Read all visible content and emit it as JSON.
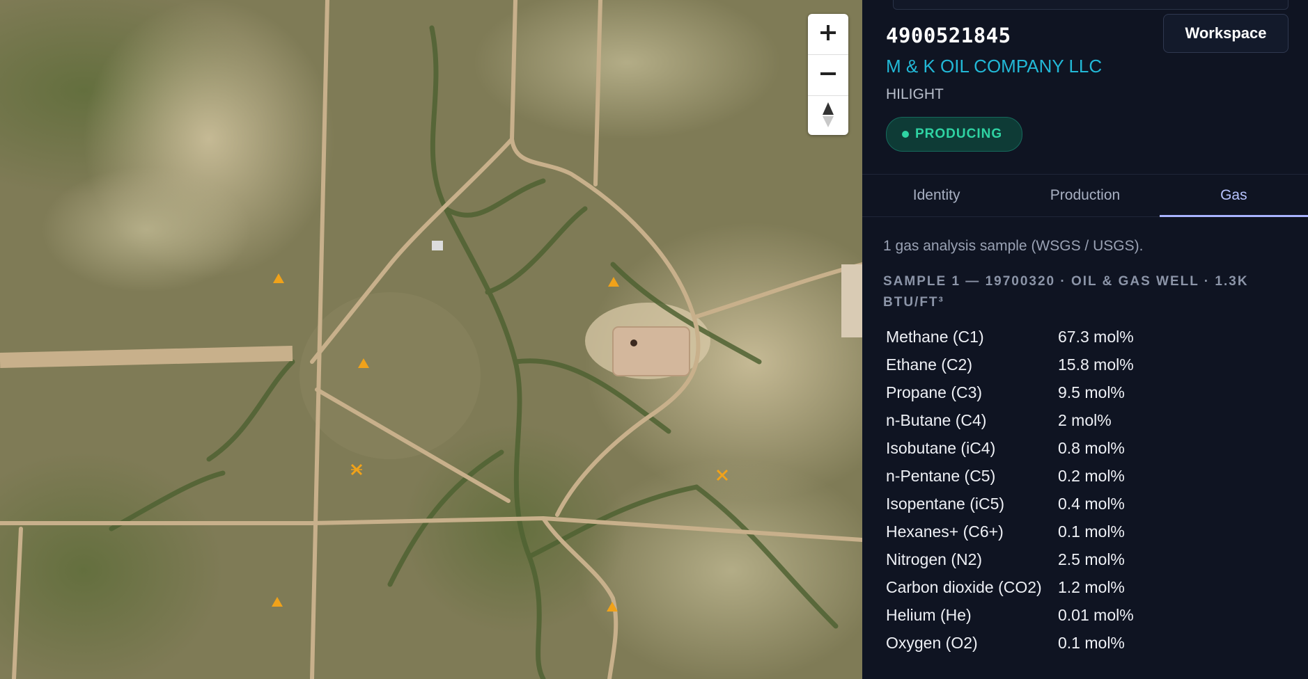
{
  "map": {
    "zoom_in_icon": "plus-icon",
    "zoom_out_icon": "minus-icon",
    "compass_icon": "compass-north-icon",
    "marker_color": "#f0a21a",
    "markers": [
      {
        "type": "triangle",
        "icon": "well-triangle-icon"
      },
      {
        "type": "triangle",
        "icon": "well-triangle-icon"
      },
      {
        "type": "triangle",
        "icon": "well-triangle-icon"
      },
      {
        "type": "cross",
        "icon": "plugged-well-cross-icon"
      },
      {
        "type": "cross",
        "icon": "plugged-well-cross-icon"
      },
      {
        "type": "triangle",
        "icon": "well-triangle-icon"
      },
      {
        "type": "triangle",
        "icon": "well-triangle-icon"
      }
    ]
  },
  "well": {
    "api": "4900521845",
    "operator": "M & K OIL COMPANY LLC",
    "name": "HILIGHT",
    "status": "PRODUCING",
    "status_color": "#2fd3a3"
  },
  "header": {
    "workspace_label": "Workspace"
  },
  "tabs": [
    {
      "label": "Identity",
      "active": false
    },
    {
      "label": "Production",
      "active": false
    },
    {
      "label": "Gas",
      "active": true
    }
  ],
  "gas": {
    "summary": "1 gas analysis sample (WSGS / USGS).",
    "sample_heading": "SAMPLE 1 — 19700320 · OIL & GAS WELL · 1.3K BTU/FT³",
    "components": [
      {
        "name": "Methane (C1)",
        "value": "67.3 mol%"
      },
      {
        "name": "Ethane (C2)",
        "value": "15.8 mol%"
      },
      {
        "name": "Propane (C3)",
        "value": "9.5 mol%"
      },
      {
        "name": "n-Butane (C4)",
        "value": "2 mol%"
      },
      {
        "name": "Isobutane (iC4)",
        "value": "0.8 mol%"
      },
      {
        "name": "n-Pentane (C5)",
        "value": "0.2 mol%"
      },
      {
        "name": "Isopentane (iC5)",
        "value": "0.4 mol%"
      },
      {
        "name": "Hexanes+ (C6+)",
        "value": "0.1 mol%"
      },
      {
        "name": "Nitrogen (N2)",
        "value": "2.5 mol%"
      },
      {
        "name": "Carbon dioxide (CO2)",
        "value": "1.2 mol%"
      },
      {
        "name": "Helium (He)",
        "value": "0.01 mol%"
      },
      {
        "name": "Oxygen (O2)",
        "value": "0.1 mol%"
      }
    ]
  }
}
